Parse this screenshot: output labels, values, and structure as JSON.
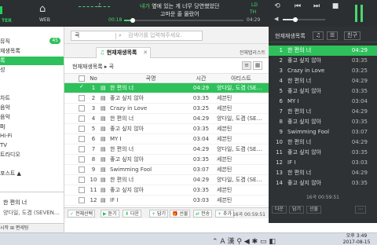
{
  "colors": {
    "accent": "#2ec15b",
    "topbar": "#2b2f31",
    "right_panel": "#2e3234"
  },
  "topbar": {
    "logo_label": "TER",
    "web_label": "WEB",
    "note_icon": "music-note-icon",
    "lyrics_line1_highlight": "내가",
    "lyrics_line1_rest": " 옆에 있는 게 너무 당연했었던",
    "lyrics_line2": "고마운 줄 몰랐어",
    "tag_ld": "LD",
    "tag_th": "TH",
    "elapsed": "00:18",
    "total": "04:29",
    "progress": 0.07,
    "volume": 0.3
  },
  "sidebar": {
    "badge": "45",
    "items": [
      {
        "label": "",
        "active": false
      },
      {
        "label": "뮤직",
        "active": false
      },
      {
        "label": "재생목록",
        "active": false
      },
      {
        "label": "록",
        "active": true
      },
      {
        "label": "성",
        "active": false
      },
      {
        "label": "",
        "active": false
      },
      {
        "label": "",
        "active": false
      },
      {
        "label": "차트",
        "active": false
      },
      {
        "label": "음악",
        "active": false
      },
      {
        "label": "음악",
        "active": false
      },
      {
        "label": "BJ",
        "active": false
      },
      {
        "label": "Hi-Fi",
        "active": false
      },
      {
        "label": "TV",
        "active": false
      },
      {
        "label": "트라디오",
        "active": false
      },
      {
        "label": "",
        "active": false
      },
      {
        "label": "포스트 ▲",
        "active": false
      }
    ],
    "now_playing_title": "한 편의 너",
    "now_playing_artist": "양다일, 도겸 (SEVEN…",
    "bottom_label": "시작   ⊞ 편세팅"
  },
  "middle": {
    "search_query": "곡",
    "search_placeholder": "검색어를 입력해주세요.",
    "tab_label": "현재재생목록",
    "tab_all_label": "전체탭리스트",
    "breadcrumb": "현재재생목록 ▸ 곡",
    "columns": {
      "no": "No",
      "title": "곡명",
      "time": "시간",
      "artist": "아티스트"
    },
    "rows": [
      {
        "no": "1",
        "title": "한 편의 너",
        "time": "04:29",
        "artist": "양다일, 도겸 (SE…",
        "checked": true,
        "playing": true
      },
      {
        "no": "2",
        "title": "좋고 싶지 않아",
        "time": "03:35",
        "artist": "세븐틴",
        "checked": false,
        "playing": false
      },
      {
        "no": "3",
        "title": "Crazy in Love",
        "time": "03:25",
        "artist": "세븐틴",
        "checked": false,
        "playing": false
      },
      {
        "no": "4",
        "title": "한 편의 너",
        "time": "04:29",
        "artist": "양다일, 도겸 (SE…",
        "checked": false,
        "playing": false
      },
      {
        "no": "5",
        "title": "좋고 싶지 않아",
        "time": "03:35",
        "artist": "세븐틴",
        "checked": false,
        "playing": false
      },
      {
        "no": "6",
        "title": "MY I",
        "time": "03:04",
        "artist": "세븐틴",
        "checked": false,
        "playing": false
      },
      {
        "no": "7",
        "title": "한 편의 너",
        "time": "04:29",
        "artist": "양다일, 도겸 (SE…",
        "checked": false,
        "playing": false
      },
      {
        "no": "8",
        "title": "좋고 싶지 않아",
        "time": "03:35",
        "artist": "세븐틴",
        "checked": false,
        "playing": false
      },
      {
        "no": "9",
        "title": "Swimming Fool",
        "time": "03:07",
        "artist": "세븐틴",
        "checked": false,
        "playing": false
      },
      {
        "no": "10",
        "title": "한 편의 너",
        "time": "04:29",
        "artist": "양다일, 도겸 (SE…",
        "checked": false,
        "playing": false
      },
      {
        "no": "11",
        "title": "좋고 싶지 않아",
        "time": "03:35",
        "artist": "세븐틴",
        "checked": false,
        "playing": false
      },
      {
        "no": "12",
        "title": "IF I",
        "time": "03:03",
        "artist": "세븐틴",
        "checked": false,
        "playing": false
      }
    ],
    "footer": {
      "select_all": "전체선택",
      "play": "듣기",
      "add_to": "다운",
      "put": "담기",
      "delete": "선물",
      "move": "전송",
      "append": "추가",
      "count": "16곡 00:59:51"
    }
  },
  "right": {
    "tab_label": "현재재생목록",
    "btn_list": "♫",
    "btn_friend": "친구",
    "rows": [
      {
        "no": "1",
        "title": "한 편의 너",
        "time": "04:29",
        "playing": true
      },
      {
        "no": "2",
        "title": "좋고 싶지 않아",
        "time": "03:35",
        "playing": false
      },
      {
        "no": "3",
        "title": "Crazy in Love",
        "time": "03:25",
        "playing": false
      },
      {
        "no": "4",
        "title": "한 편의 너",
        "time": "04:29",
        "playing": false
      },
      {
        "no": "5",
        "title": "좋고 싶지 않아",
        "time": "03:35",
        "playing": false
      },
      {
        "no": "6",
        "title": "MY I",
        "time": "03:04",
        "playing": false
      },
      {
        "no": "7",
        "title": "한 편의 너",
        "time": "04:29",
        "playing": false
      },
      {
        "no": "8",
        "title": "좋고 싶지 않아",
        "time": "03:35",
        "playing": false
      },
      {
        "no": "9",
        "title": "Swimming Fool",
        "time": "03:07",
        "playing": false
      },
      {
        "no": "10",
        "title": "한 편의 너",
        "time": "04:29",
        "playing": false
      },
      {
        "no": "11",
        "title": "좋고 싶지 않아",
        "time": "03:35",
        "playing": false
      },
      {
        "no": "12",
        "title": "IF I",
        "time": "03:03",
        "playing": false
      },
      {
        "no": "13",
        "title": "한 편의 너",
        "time": "04:29",
        "playing": false
      },
      {
        "no": "14",
        "title": "좋고 싶지 않아",
        "time": "03:35",
        "playing": false
      }
    ],
    "status": "16곡 00:59:51",
    "footer": {
      "btn1": "다운",
      "btn2": "담기",
      "btn3": "선물"
    }
  },
  "taskbar": {
    "ime": "A 漢",
    "time": "오후 3:49",
    "date": "2017-08-15"
  }
}
